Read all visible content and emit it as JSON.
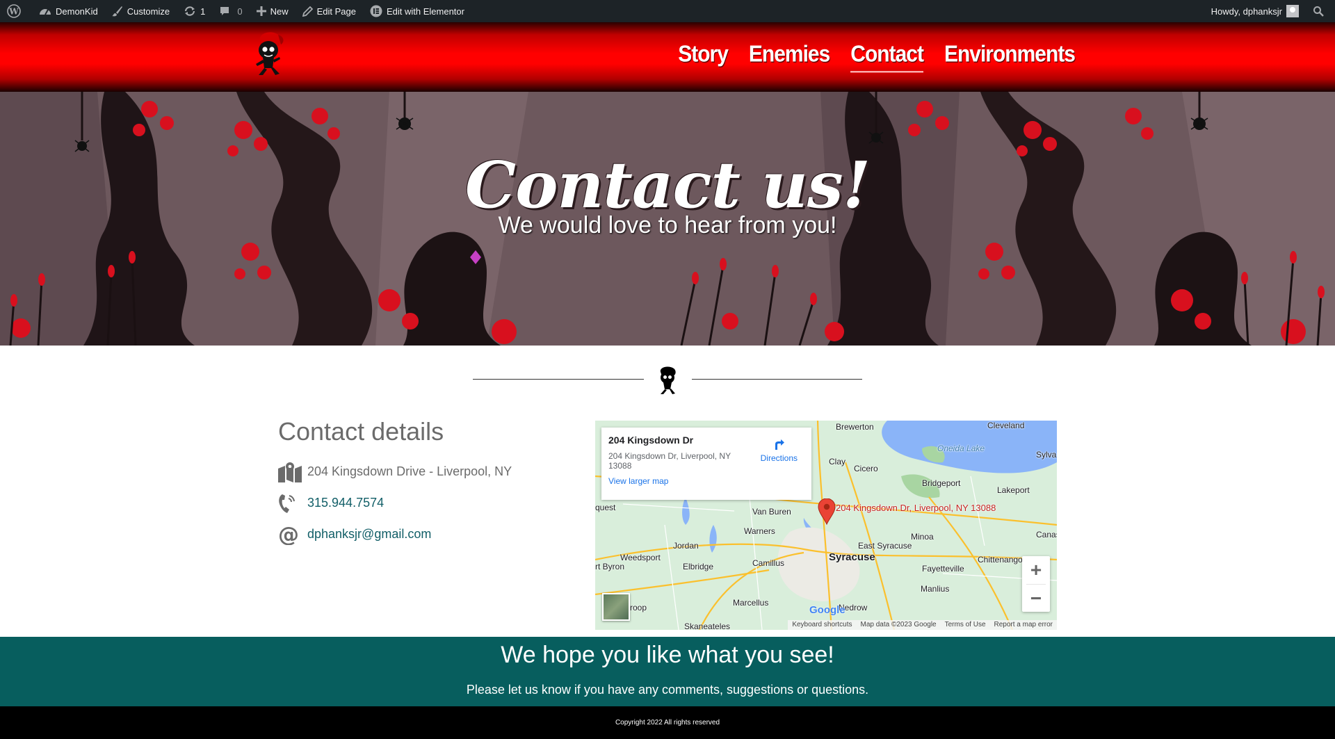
{
  "admin_bar": {
    "site_name": "DemonKid",
    "customize": "Customize",
    "updates_count": "1",
    "comments_count": "0",
    "new": "New",
    "edit_page": "Edit Page",
    "edit_elementor": "Edit with Elementor",
    "howdy": "Howdy, dphanksjr"
  },
  "nav": {
    "items": [
      {
        "label": "Story",
        "active": false
      },
      {
        "label": "Enemies",
        "active": false
      },
      {
        "label": "Contact",
        "active": true
      },
      {
        "label": "Environments",
        "active": false
      }
    ]
  },
  "hero": {
    "title": "Contact us!",
    "subtitle": "We would love to hear from you!"
  },
  "contact": {
    "heading": "Contact details",
    "address": "204 Kingsdown Drive - Liverpool, NY",
    "phone": "315.944.7574",
    "email": "dphanksjr@gmail.com"
  },
  "map": {
    "info_title": "204 Kingsdown Dr",
    "info_address": "204 Kingsdown Dr, Liverpool, NY 13088",
    "directions": "Directions",
    "view_larger": "View larger map",
    "pin_label": "204 Kingsdown Dr, Liverpool, NY 13088",
    "places": [
      "Brewerton",
      "Cleveland",
      "Oneida Lake",
      "Sylva",
      "Clay",
      "Cicero",
      "Bridgeport",
      "Lakeport",
      "quest",
      "Van Buren",
      "Warners",
      "Jordan",
      "Minoa",
      "Canast",
      "East Syracuse",
      "Weedsport",
      "Syracuse",
      "Chittenango",
      "rt Byron",
      "Elbridge",
      "Camillus",
      "Fayetteville",
      "Manlius",
      "Marcellus",
      "Nedrow",
      "roop",
      "Skaneateles"
    ],
    "footer": [
      "Keyboard shortcuts",
      "Map data ©2023 Google",
      "Terms of Use",
      "Report a map error"
    ],
    "google": "Google"
  },
  "band": {
    "heading": "We hope you like what you see!",
    "text": "Please let us know if you have any comments, suggestions or questions."
  },
  "copyright": "Copyright 2022 All rights reserved",
  "colors": {
    "admin_bar": "#1d2327",
    "header_red": "#ff0000",
    "teal_link": "#115e67",
    "footer_band": "#075e5e"
  }
}
